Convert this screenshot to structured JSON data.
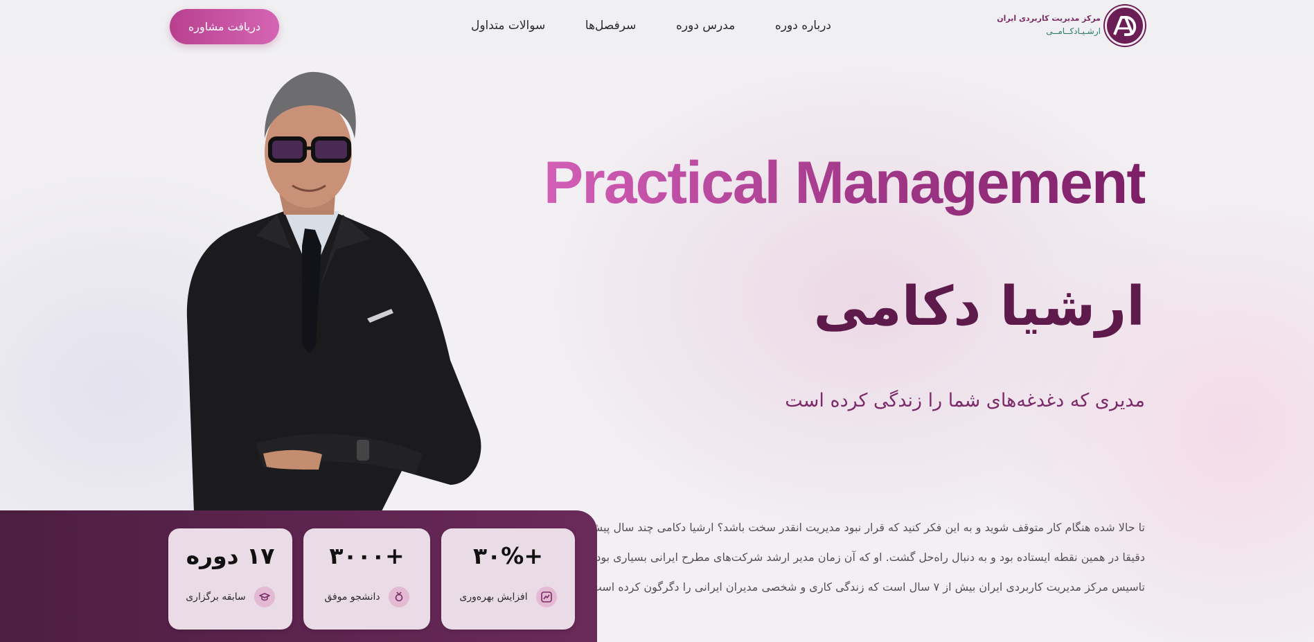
{
  "header": {
    "logo_line1": "مرکز مدیریت کاربردی ایران",
    "logo_line2": "ارشـیـادکــامــی",
    "nav": [
      {
        "label": "درباره دوره"
      },
      {
        "label": "مدرس دوره"
      },
      {
        "label": "سرفصل‌ها"
      },
      {
        "label": "سوالات متداول"
      }
    ],
    "cta_label": "دریافت مشاوره"
  },
  "hero": {
    "title_en": "Practical Management",
    "name": "ارشیا دکامی",
    "tagline": "مدیری که دغدغه‌های شما را زندگی کرده است",
    "intro": "تا حالا شده هنگام کار متوقف شوید و به این فکر کنید که قرار نبود مدیریت انقدر سخت باشد؟ ارشیا دکامی چند سال پیش دقیقا در همین نقطه ایستاده بود و به دنبال راه‌حل گشت. او که آن زمان مدیر ارشد شرکت‌های مطرح ایرانی بسیاری بود، با تاسیس مرکز مدیریت کاربردی ایران بیش از ۷ سال است که زندگی کاری و شخصی مدیران ایرانی را دگرگون کرده است."
  },
  "stats": [
    {
      "value": "+۳۰%",
      "label": "افزایش بهره‌وری",
      "icon": "growth-chart-icon"
    },
    {
      "value": "+۳۰۰۰",
      "label": "دانشجو موفق",
      "icon": "medal-icon"
    },
    {
      "value": "۱۷ دوره",
      "label": "سابقه برگزاری",
      "icon": "graduation-cap-icon"
    }
  ],
  "colors": {
    "accent": "#b8418f",
    "brand_dark": "#5e1a4b",
    "panel": "#5e2450",
    "card": "#eadce6"
  }
}
